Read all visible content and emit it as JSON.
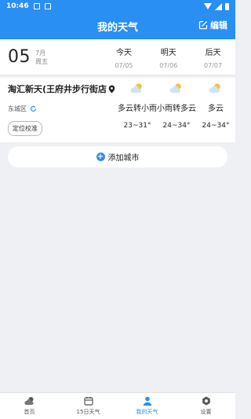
{
  "status_bar": {
    "time": "10:46"
  },
  "app_bar": {
    "title": "我的天气",
    "edit_label": "编辑"
  },
  "date_bar": {
    "day": "05",
    "month": "7月",
    "weekday": "周五",
    "days": [
      {
        "name": "今天",
        "date": "07/05"
      },
      {
        "name": "明天",
        "date": "07/06"
      },
      {
        "name": "后天",
        "date": "07/07"
      }
    ]
  },
  "city": {
    "name": "淘汇新天(王府井步行街店",
    "district": "东城区",
    "calibrate_label": "定位校准",
    "forecast": [
      {
        "condition": "多云转小雨",
        "temp": "23~31°",
        "icon": "partly-cloudy-icon"
      },
      {
        "condition": "小雨转多云",
        "temp": "24~34°",
        "icon": "partly-cloudy-icon"
      },
      {
        "condition": "多云",
        "temp": "24~34°",
        "icon": "partly-cloudy-icon"
      }
    ]
  },
  "add_city_label": "添加城市",
  "bottom_nav": [
    {
      "label": "首页",
      "icon": "home-weather-icon"
    },
    {
      "label": "15日天气",
      "icon": "calendar-icon"
    },
    {
      "label": "我的天气",
      "icon": "person-icon",
      "active": true
    },
    {
      "label": "设置",
      "icon": "settings-icon"
    }
  ],
  "colors": {
    "accent": "#2a8ff2",
    "background": "#eef0f4"
  }
}
